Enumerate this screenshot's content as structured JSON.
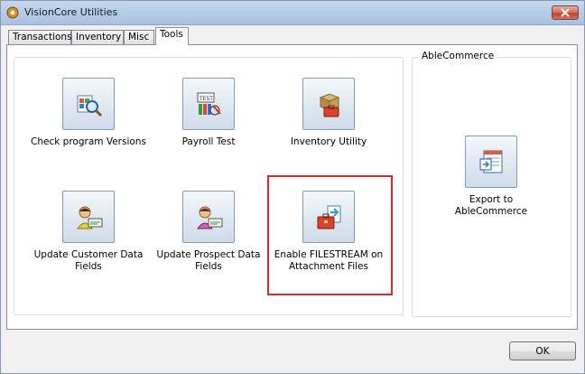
{
  "window": {
    "title": "VisionCore Utilities"
  },
  "tabs": [
    {
      "label": "Transactions",
      "active": false
    },
    {
      "label": "Inventory",
      "active": false
    },
    {
      "label": "Misc",
      "active": false
    },
    {
      "label": "Tools",
      "active": true
    }
  ],
  "tools": [
    {
      "label": "Check program Versions",
      "icon": "magnifier-cube-icon"
    },
    {
      "label": "Payroll Test",
      "icon": "payroll-test-icon"
    },
    {
      "label": "Inventory Utility",
      "icon": "boxes-toolbox-icon"
    },
    {
      "label": "Update Customer Data Fields",
      "icon": "user-data-icon"
    },
    {
      "label": "Update Prospect Data Fields",
      "icon": "prospect-data-icon"
    },
    {
      "label": "Enable FILESTREAM on Attachment Files",
      "icon": "toolbox-file-icon",
      "highlighted": true
    }
  ],
  "ablecommerce": {
    "group_label": "AbleCommerce",
    "export_label": "Export to AbleCommerce",
    "export_icon": "export-window-icon"
  },
  "footer": {
    "ok_label": "OK"
  },
  "colors": {
    "highlight": "#e0262b",
    "titlebar": "#b7cde8",
    "close": "#c1412a"
  }
}
